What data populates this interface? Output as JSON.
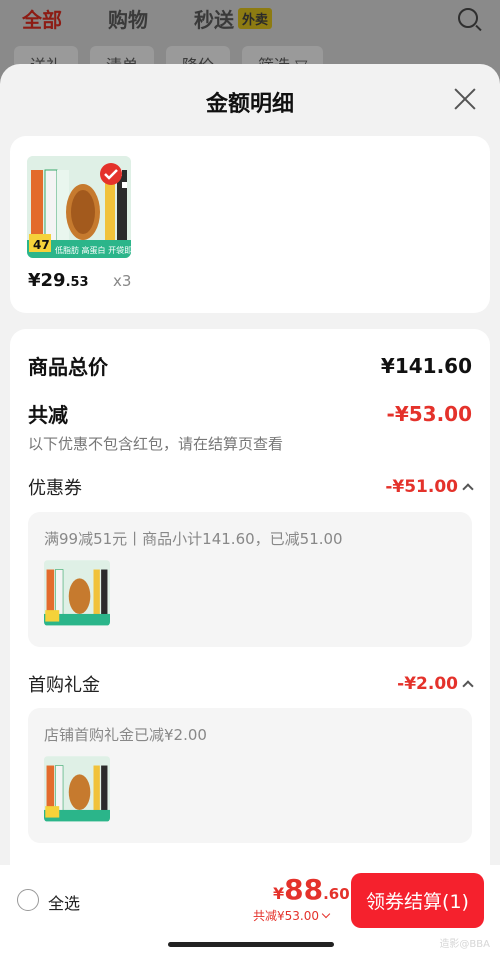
{
  "background": {
    "tabs": [
      "全部",
      "购物",
      "秒送"
    ],
    "tag": "外卖",
    "filters": [
      "送礼",
      "清单",
      "降价",
      "筛选 ▽"
    ]
  },
  "sheet": {
    "title": "金额明细",
    "product": {
      "price_int": "¥29",
      "price_dec": ".53",
      "qty": "x3",
      "image_badge": "47",
      "image_caption": "低脂肪 高蛋白 开袋即食"
    },
    "summary": {
      "goods_total_label": "商品总价",
      "goods_total_value": "¥141.60",
      "discount_label": "共减",
      "discount_value": "-¥53.00",
      "note": "以下优惠不包含红包，请在结算页查看",
      "coupon_label": "优惠券",
      "coupon_value": "-¥51.00",
      "coupon_detail": "满99减51元丨商品小计141.60，已减51.00",
      "gift_label": "首购礼金",
      "gift_value": "-¥2.00",
      "gift_detail": "店铺首购礼金已减¥2.00"
    }
  },
  "bottom_bar": {
    "select_all": "全选",
    "total_yen": "¥",
    "total_int": "88",
    "total_dec": ".60",
    "total_discount": "共减¥53.00",
    "checkout_label": "领券结算(1)",
    "watermark": "造影@BBA"
  },
  "colors": {
    "accent": "#f5212d",
    "red_text": "#e4322b"
  }
}
